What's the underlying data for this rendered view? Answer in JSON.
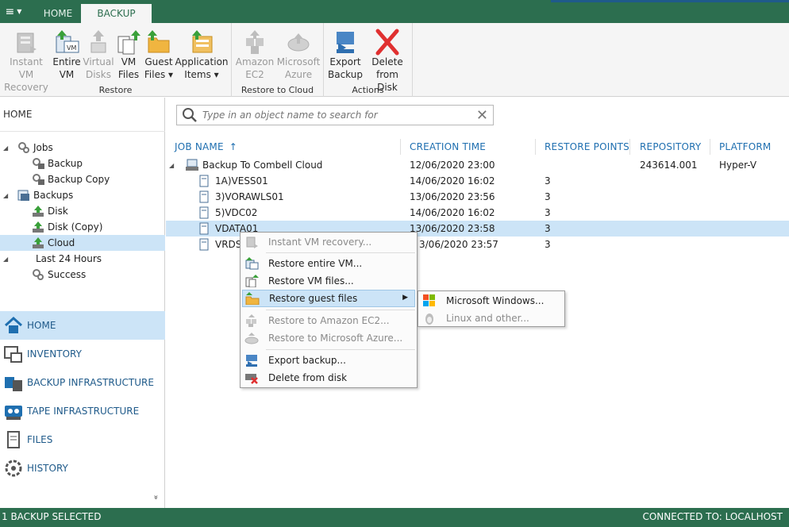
{
  "topbar": {
    "menu_glyph": "≡",
    "tabs": [
      {
        "label": "HOME",
        "active": false
      },
      {
        "label": "BACKUP",
        "active": true
      }
    ]
  },
  "ribbon": {
    "groups": [
      {
        "label": "Restore",
        "buttons": [
          {
            "label": "Instant VM\nRecovery",
            "icon": "instant-vm-recovery-icon",
            "enabled": false
          },
          {
            "label": "Entire\nVM",
            "icon": "entire-vm-icon",
            "enabled": true
          },
          {
            "label": "Virtual\nDisks",
            "icon": "virtual-disks-icon",
            "enabled": false
          },
          {
            "label": "VM\nFiles",
            "icon": "vm-files-icon",
            "enabled": true
          },
          {
            "label": "Guest\nFiles ▾",
            "icon": "guest-files-icon",
            "enabled": true
          },
          {
            "label": "Application\nItems ▾",
            "icon": "application-items-icon",
            "enabled": true
          }
        ]
      },
      {
        "label": "Restore to Cloud",
        "buttons": [
          {
            "label": "Amazon\nEC2",
            "icon": "amazon-ec2-icon",
            "enabled": false
          },
          {
            "label": "Microsoft\nAzure",
            "icon": "microsoft-azure-icon",
            "enabled": false
          }
        ]
      },
      {
        "label": "Actions",
        "buttons": [
          {
            "label": "Export\nBackup",
            "icon": "export-backup-icon",
            "enabled": true
          },
          {
            "label": "Delete\nfrom Disk",
            "icon": "delete-from-disk-icon",
            "enabled": true
          }
        ]
      }
    ]
  },
  "sidebar": {
    "title": "HOME",
    "tree": [
      {
        "label": "Jobs",
        "level": 0,
        "expander": "◢",
        "icon": "jobs-icon"
      },
      {
        "label": "Backup",
        "level": 1,
        "icon": "backup-job-icon"
      },
      {
        "label": "Backup Copy",
        "level": 1,
        "icon": "backup-copy-job-icon"
      },
      {
        "label": "Backups",
        "level": 0,
        "expander": "◢",
        "icon": "backups-icon"
      },
      {
        "label": "Disk",
        "level": 1,
        "icon": "disk-icon"
      },
      {
        "label": "Disk (Copy)",
        "level": 1,
        "icon": "disk-copy-icon"
      },
      {
        "label": "Cloud",
        "level": 1,
        "icon": "cloud-icon",
        "selected": true
      },
      {
        "label": "Last 24 Hours",
        "level": 0,
        "expander": "◢",
        "icon": "last-24-hours-icon"
      },
      {
        "label": "Success",
        "level": 1,
        "icon": "success-icon"
      }
    ],
    "nav": [
      {
        "label": "HOME",
        "icon": "home-icon",
        "active": true
      },
      {
        "label": "INVENTORY",
        "icon": "inventory-icon"
      },
      {
        "label": "BACKUP INFRASTRUCTURE",
        "icon": "backup-infrastructure-icon"
      },
      {
        "label": "TAPE INFRASTRUCTURE",
        "icon": "tape-infrastructure-icon"
      },
      {
        "label": "FILES",
        "icon": "files-icon"
      },
      {
        "label": "HISTORY",
        "icon": "history-icon"
      }
    ],
    "collapse_glyph": "»"
  },
  "search": {
    "placeholder": "Type in an object name to search for",
    "clear_glyph": "✕"
  },
  "grid": {
    "columns": [
      "JOB NAME",
      "CREATION TIME",
      "RESTORE POINTS",
      "REPOSITORY",
      "PLATFORM"
    ],
    "sort_glyph": "↑",
    "parent": {
      "name": "Backup To Combell Cloud",
      "creation_time": "12/06/2020 23:00",
      "restore_points": "",
      "repository": "243614.001",
      "platform": "Hyper-V",
      "expander": "◢"
    },
    "rows": [
      {
        "name": "1A)VESS01",
        "creation_time": "14/06/2020 16:02",
        "restore_points": "3"
      },
      {
        "name": "3)VORAWLS01",
        "creation_time": "13/06/2020 23:56",
        "restore_points": "3"
      },
      {
        "name": "5)VDC02",
        "creation_time": "14/06/2020 16:02",
        "restore_points": "3"
      },
      {
        "name": "VDATA01",
        "creation_time": "13/06/2020 23:58",
        "restore_points": "3",
        "selected": true
      },
      {
        "name": "VRDS0",
        "creation_time": "3/06/2020 23:57",
        "restore_points": "3"
      }
    ]
  },
  "context_menu": {
    "items": [
      {
        "label": "Instant VM recovery...",
        "icon": "instant-vm-recovery-icon",
        "enabled": false
      },
      {
        "label": "Restore entire VM...",
        "icon": "entire-vm-icon",
        "enabled": true
      },
      {
        "label": "Restore VM files...",
        "icon": "vm-files-icon",
        "enabled": true
      },
      {
        "label": "Restore guest files",
        "icon": "guest-files-icon",
        "enabled": true,
        "submenu": true
      },
      {
        "label": "Restore to Amazon EC2...",
        "icon": "amazon-ec2-icon",
        "enabled": false
      },
      {
        "label": "Restore to Microsoft Azure...",
        "icon": "microsoft-azure-icon",
        "enabled": false
      },
      {
        "label": "Export backup...",
        "icon": "export-backup-icon",
        "enabled": true
      },
      {
        "label": "Delete from disk",
        "icon": "delete-from-disk-icon",
        "enabled": true
      }
    ],
    "submenu_arrow": "▶"
  },
  "submenu": {
    "items": [
      {
        "label": "Microsoft Windows...",
        "icon": "windows-logo-icon",
        "enabled": true
      },
      {
        "label": "Linux and other...",
        "icon": "linux-penguin-icon",
        "enabled": false
      }
    ]
  },
  "status": {
    "left": "1 BACKUP SELECTED",
    "right": "CONNECTED TO: LOCALHOST"
  },
  "colors": {
    "brand_green": "#2c6e4f",
    "selection_blue": "#cce4f7",
    "link_blue": "#1f6fb0",
    "delete_red": "#e03030",
    "arrow_green": "#3aa03a"
  }
}
